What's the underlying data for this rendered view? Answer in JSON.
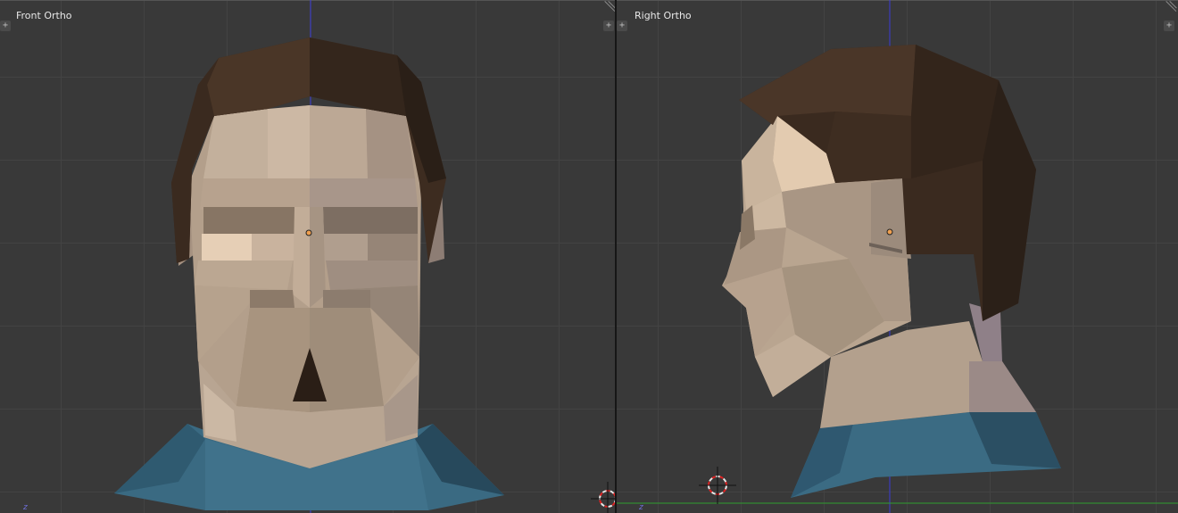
{
  "viewports": [
    {
      "label": "Front Ortho",
      "axis_label": "z"
    },
    {
      "label": "Right Ortho",
      "axis_label": "z"
    }
  ],
  "colors": {
    "background": "#393939",
    "grid": "#434343",
    "z_axis": "#3a3ad6",
    "y_axis": "#2e9e2e",
    "skin": "#b09b87",
    "hair": "#3a2a1f",
    "shirt": "#3c6e86",
    "origin_dot": "#f0a050"
  },
  "icons": [
    "plus-icon",
    "corner-drag-icon",
    "3d-cursor-icon",
    "origin-point-icon"
  ]
}
